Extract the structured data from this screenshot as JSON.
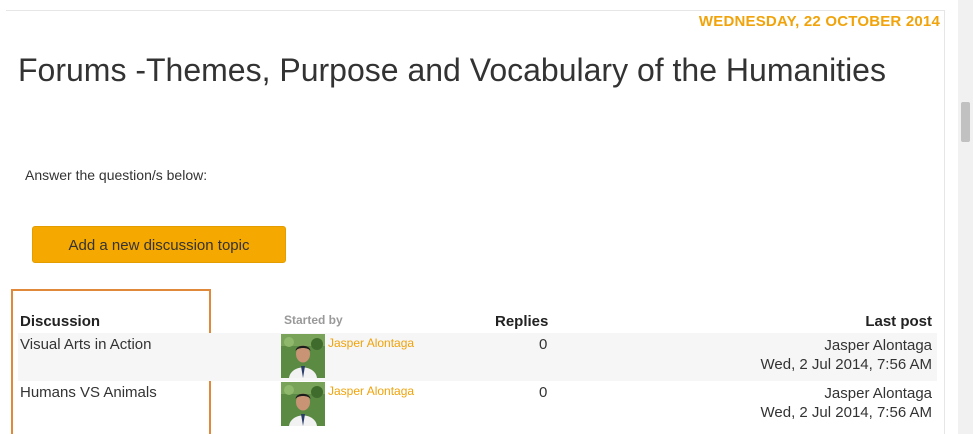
{
  "header": {
    "date": "WEDNESDAY, 22 OCTOBER 2014",
    "title": "Forums -Themes, Purpose and Vocabulary of the Humanities"
  },
  "intro_text": "Answer the question/s below:",
  "add_button_label": "Add a new discussion topic",
  "table": {
    "columns": {
      "discussion": "Discussion",
      "started_by": "Started by",
      "replies": "Replies",
      "last_post": "Last post"
    },
    "rows": [
      {
        "discussion": "Visual Arts in Action",
        "started_by": "Jasper Alontaga",
        "replies": "0",
        "last_post_author": "Jasper Alontaga",
        "last_post_date": "Wed, 2 Jul 2014, 7:56 AM"
      },
      {
        "discussion": "Humans VS Animals",
        "started_by": "Jasper Alontaga",
        "replies": "0",
        "last_post_author": "Jasper Alontaga",
        "last_post_date": "Wed, 2 Jul 2014, 7:56 AM"
      }
    ]
  },
  "colors": {
    "accent": "#f0a30a",
    "button": "#f5a800",
    "highlight_border": "#e0893a",
    "row_background": "#f6f6f6"
  },
  "icons": {
    "avatar": "user-avatar-photo"
  }
}
